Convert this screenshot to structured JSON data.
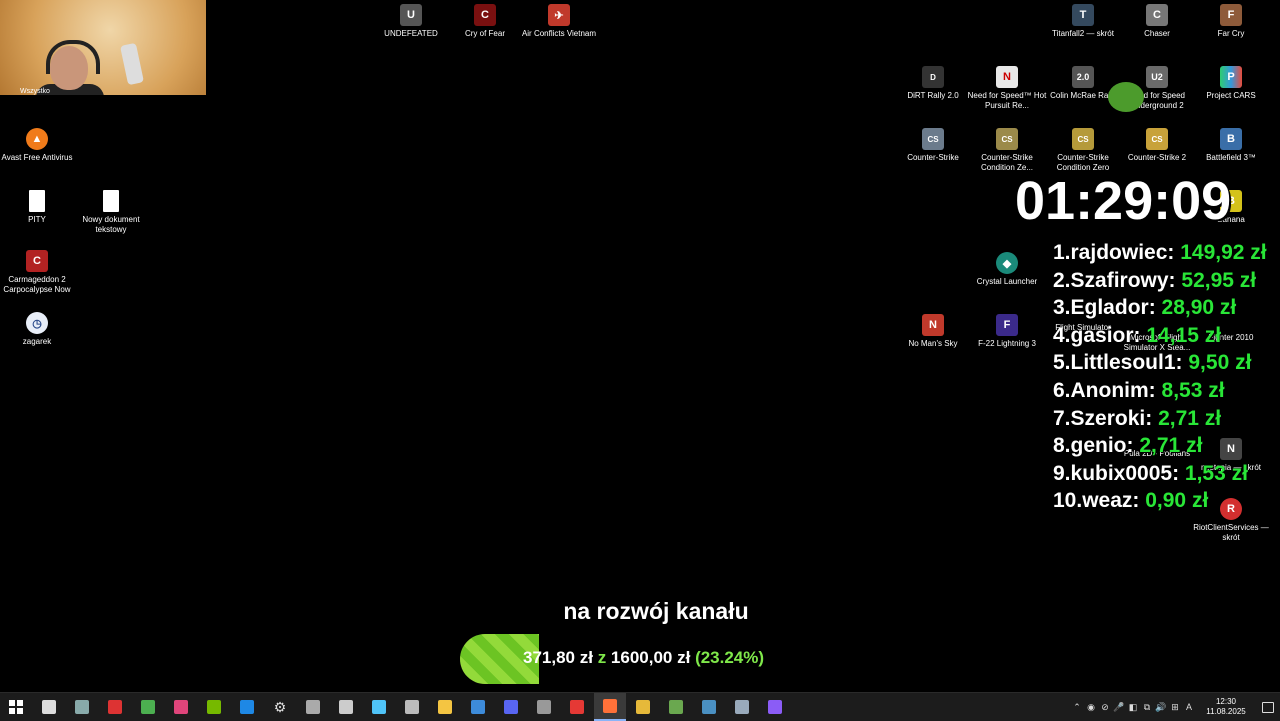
{
  "desktop": {
    "icons_left": [
      {
        "label": "Avast Free Antivirus",
        "color": "#f07b1a",
        "glyph": "▲",
        "icon": "avast-icon"
      },
      {
        "label": "PITY",
        "color": "#ffffff",
        "glyph": "",
        "icon": "document-icon"
      },
      {
        "label": "Nowy dokument tekstowy",
        "color": "#ffffff",
        "glyph": "",
        "icon": "document-icon"
      },
      {
        "label": "Carmageddon 2 Carpocalypse Now",
        "color": "#b22222",
        "glyph": "C",
        "icon": "carmageddon-icon"
      },
      {
        "label": "zagarek",
        "color": "#e8eef8",
        "glyph": "◷",
        "icon": "clock-icon"
      }
    ],
    "webcam_partial_label": "Wszystko",
    "icons_top": [
      {
        "label": "UNDEFEATED",
        "color": "#555555",
        "glyph": "U"
      },
      {
        "label": "Cry of Fear",
        "color": "#7a1010",
        "glyph": "C"
      },
      {
        "label": "Air Conflicts Vietnam",
        "color": "#c0392b",
        "glyph": "✈"
      }
    ],
    "icons_right": [
      {
        "label": "Titanfall2 — skrót",
        "color": "#34495e",
        "glyph": "T"
      },
      {
        "label": "Chaser",
        "color": "#777777",
        "glyph": "C"
      },
      {
        "label": "Far Cry",
        "color": "#8e5b3a",
        "glyph": "F"
      },
      {
        "label": "DiRT Rally 2.0",
        "color": "#333333",
        "glyph": "D"
      },
      {
        "label": "Need for Speed™ Hot Pursuit Re...",
        "color": "#e8e8e8",
        "glyph": "N"
      },
      {
        "label": "Colin McRae Rally",
        "color": "#555555",
        "glyph": "2.0"
      },
      {
        "label": "Need for Speed Underground 2",
        "color": "#6a6a6a",
        "glyph": "U2"
      },
      {
        "label": "Project CARS",
        "color": "#2ecc71",
        "glyph": "P"
      },
      {
        "label": "Counter-Strike",
        "color": "#6b7b8c",
        "glyph": "CS"
      },
      {
        "label": "Counter-Strike Condition Ze...",
        "color": "#9b8a4a",
        "glyph": "CS"
      },
      {
        "label": "Counter-Strike Condition Zero",
        "color": "#b59a3a",
        "glyph": "CS"
      },
      {
        "label": "Counter-Strike 2",
        "color": "#c8a23a",
        "glyph": "CS"
      },
      {
        "label": "Battlefield 3™",
        "color": "#3a6ea8",
        "glyph": "B"
      },
      {
        "label": "Banana",
        "color": "#d4c21a",
        "glyph": "B"
      },
      {
        "label": "Crystal Launcher",
        "color": "#1a8a7a",
        "glyph": "◆"
      },
      {
        "label": "No Man's Sky",
        "color": "#c0392b",
        "glyph": "N"
      },
      {
        "label": "F-22 Lightning 3",
        "color": "#3b2a8a",
        "glyph": "F"
      },
      {
        "label": "Flight Simulator",
        "color": "#2a6aa8",
        "glyph": "✈"
      },
      {
        "label": "Microsoft Flight Simulator X Stea...",
        "color": "#2a6aa8",
        "glyph": "✈"
      },
      {
        "label": "Fighter 2010",
        "color": "#c0392b",
        "glyph": "F"
      },
      {
        "label": "Pula 2D - Poolians",
        "color": "#1a8a3a",
        "glyph": "P"
      },
      {
        "label": "nestopia — skrót",
        "color": "#444444",
        "glyph": "N"
      },
      {
        "label": "RiotClientServices — skrót",
        "color": "#d32f2f",
        "glyph": "R"
      }
    ]
  },
  "overlay": {
    "timer": "01:29:09",
    "leaderboard": [
      {
        "name": "1.rajdowiec:",
        "amount": "149,92 zł"
      },
      {
        "name": "2.Szafirowy:",
        "amount": "52,95 zł"
      },
      {
        "name": "3.Eglador:",
        "amount": "28,90 zł"
      },
      {
        "name": "4.gasior:",
        "amount": "14,15 zł"
      },
      {
        "name": "5.Littlesoul1:",
        "amount": "9,50 zł"
      },
      {
        "name": "6.Anonim:",
        "amount": "8,53 zł"
      },
      {
        "name": "7.Szeroki:",
        "amount": "2,71 zł"
      },
      {
        "name": "8.genio:",
        "amount": "2,71 zł"
      },
      {
        "name": "9.kubix0005:",
        "amount": "1,53 zł"
      },
      {
        "name": "10.weaz:",
        "amount": "0,90 zł"
      }
    ],
    "goal": {
      "caption": "na rozwój kanału",
      "current": "371,80 zł",
      "separator": "z",
      "target": "1600,00 zł",
      "percent_label": "(23.24%)",
      "progress_fraction": 0.2324
    }
  },
  "taskbar": {
    "apps": [
      {
        "icon": "windows-start-icon",
        "color": "#ffffff"
      },
      {
        "icon": "task-view-icon",
        "color": "#dddddd"
      },
      {
        "icon": "app-icon",
        "color": "#8aa"
      },
      {
        "icon": "app-icon",
        "color": "#d33"
      },
      {
        "icon": "utorrent-icon",
        "color": "#4caf50"
      },
      {
        "icon": "app-icon",
        "color": "#e0457b"
      },
      {
        "icon": "nvidia-icon",
        "color": "#76b900"
      },
      {
        "icon": "app-icon",
        "color": "#1e88e5"
      },
      {
        "icon": "settings-icon",
        "color": "#dddddd"
      },
      {
        "icon": "app-icon",
        "color": "#aaaaaa"
      },
      {
        "icon": "app-icon",
        "color": "#cccccc"
      },
      {
        "icon": "app-icon",
        "color": "#4fc3f7"
      },
      {
        "icon": "calculator-icon",
        "color": "#bbbbbb"
      },
      {
        "icon": "folder-icon",
        "color": "#f4c542"
      },
      {
        "icon": "app-icon",
        "color": "#3d8bd9"
      },
      {
        "icon": "discord-icon",
        "color": "#5865f2"
      },
      {
        "icon": "app-icon",
        "color": "#999999"
      },
      {
        "icon": "app-icon",
        "color": "#e53935"
      },
      {
        "icon": "firefox-icon",
        "color": "#ff7139"
      },
      {
        "icon": "app-icon",
        "color": "#e6b93a"
      },
      {
        "icon": "app-icon",
        "color": "#6aa84f"
      },
      {
        "icon": "app-icon",
        "color": "#4a90c2"
      },
      {
        "icon": "steam-icon",
        "color": "#9ab"
      },
      {
        "icon": "app-icon",
        "color": "#8b5cf6"
      }
    ],
    "active_index": 18,
    "tray_glyphs": [
      "⌃",
      "◉",
      "⊘",
      "🎤",
      "◧",
      "⧉",
      "🔊",
      "⊞",
      "A"
    ],
    "time": "12:30",
    "date": "11.08.2025"
  }
}
